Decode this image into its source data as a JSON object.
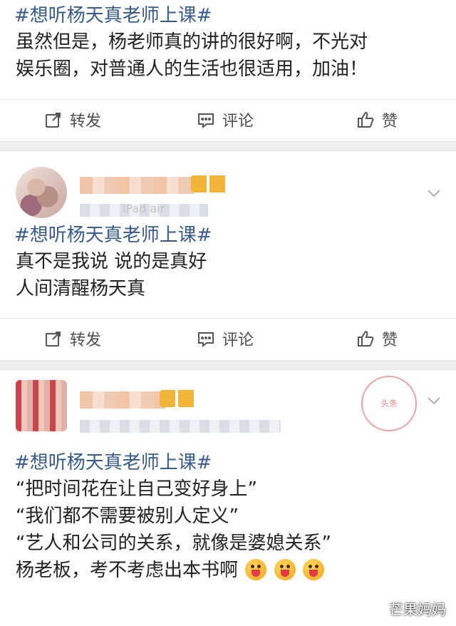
{
  "posts": [
    {
      "hashtag": "#想听杨天真老师上课#",
      "lines": [
        "虽然但是，杨老师真的讲的很好啊，不光对",
        "娱乐圈，对普通人的生活也很适用，加油！"
      ],
      "actions": {
        "repost": "转发",
        "comment": "评论",
        "like": "赞"
      }
    },
    {
      "device": "iPad air",
      "hashtag": "#想听杨天真老师上课#",
      "lines": [
        "真不是我说 说的是真好",
        "人间清醒杨天真"
      ],
      "actions": {
        "repost": "转发",
        "comment": "评论",
        "like": "赞"
      }
    },
    {
      "stamp": "头条",
      "hashtag": "#想听杨天真老师上课#",
      "lines": [
        "“把时间花在让自己变好身上”",
        "“我们都不需要被别人定义”",
        "“艺人和公司的关系，就像是婆媳关系”",
        "杨老板，考不考虑出本书啊"
      ]
    }
  ],
  "watermark": "芒果妈妈",
  "icons": {
    "repost": "repost-icon",
    "comment": "comment-icon",
    "like": "like-icon",
    "chevron": "chevron-down-icon",
    "emoji": "tongue-out-emoji-icon"
  },
  "colors": {
    "hashtag": "#375b8d",
    "text": "#222222",
    "action_text": "#4d4d4d",
    "separator": "#eeeeee"
  }
}
